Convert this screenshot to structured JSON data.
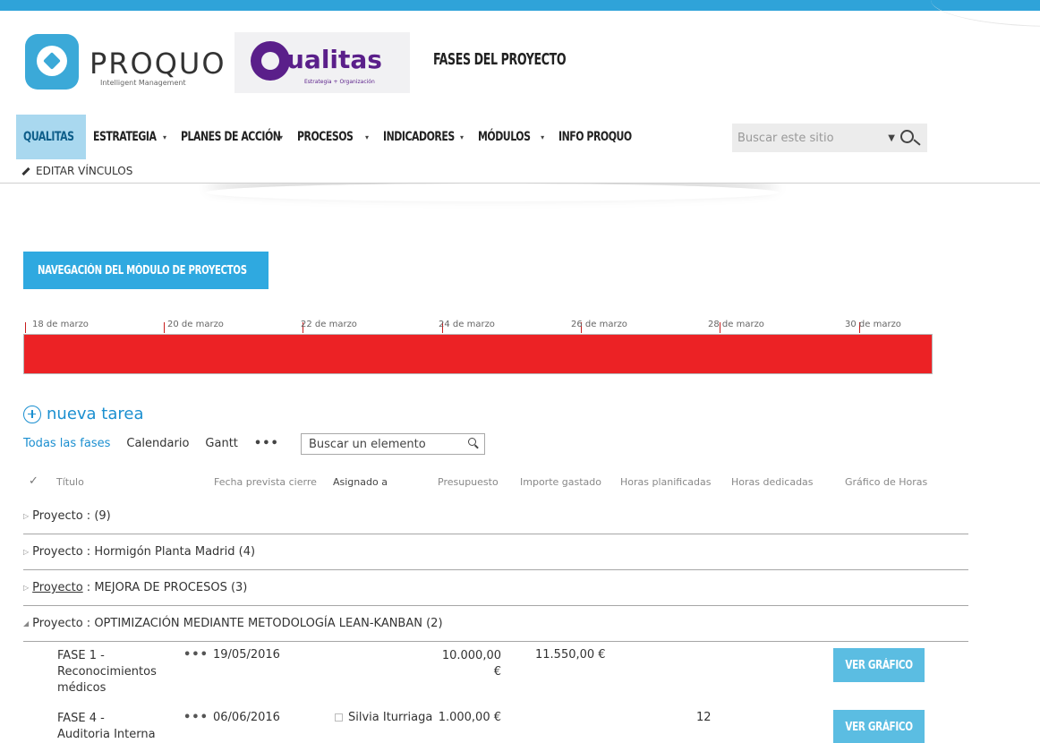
{
  "header": {
    "brand_name": "PROQUO",
    "brand_tagline": "Intelligent Management",
    "partner_name": "ualitas",
    "partner_tagline": "Estrategia + Organización",
    "page_title": "FASES DEL PROYECTO",
    "accent_color": "#2fa3d9"
  },
  "nav": {
    "items": [
      {
        "label": "QUALITAS",
        "active": true
      },
      {
        "label": "ESTRATEGIA",
        "dropdown": true
      },
      {
        "label": "PLANES DE ACCIÓN",
        "dropdown": true
      },
      {
        "label": "PROCESOS",
        "dropdown": true
      },
      {
        "label": "INDICADORES",
        "dropdown": true
      },
      {
        "label": "MÓDULOS",
        "dropdown": true
      },
      {
        "label": "INFO PROQUO"
      }
    ],
    "search_placeholder": "Buscar este sitio",
    "edit_links": "EDITAR VÍNCULOS"
  },
  "module_button": "NAVEGACIÓN DEL MÓDULO DE PROYECTOS",
  "timeline": {
    "labels": [
      "18 de marzo",
      "20 de marzo",
      "22 de marzo",
      "24 de marzo",
      "26 de marzo",
      "28 de marzo",
      "30 de marzo"
    ],
    "bar_color": "#ec2225"
  },
  "list": {
    "new_task": "nueva tarea",
    "views": [
      "Todas las fases",
      "Calendario",
      "Gantt"
    ],
    "more": "•••",
    "search_placeholder": "Buscar un elemento",
    "columns": [
      "Título",
      "Fecha prevista cierre",
      "Asignado a",
      "Presupuesto",
      "Importe gastado",
      "Horas planificadas",
      "Horas dedicadas",
      "Gráfico de Horas"
    ],
    "groups": [
      {
        "prefix": "Proyecto",
        "label": " : (9)",
        "expanded": false
      },
      {
        "prefix": "Proyecto",
        "label": " : Hormigón Planta Madrid (4)",
        "expanded": false
      },
      {
        "prefix": "Proyecto",
        "label": " : MEJORA DE PROCESOS (3)",
        "expanded": false,
        "underline": true
      },
      {
        "prefix": "Proyecto",
        "label": " : OPTIMIZACIÓN MEDIANTE METODOLOGÍA LEAN-KANBAN (2)",
        "expanded": true
      }
    ],
    "rows": [
      {
        "title_lines": [
          "FASE 1 -",
          "Reconocimientos",
          "médicos"
        ],
        "date": "19/05/2016",
        "assigned": "",
        "budget_lines": [
          "10.000,00",
          "€"
        ],
        "spent": "11.550,00 €",
        "planned": "",
        "button": "VER GRÁFICO"
      },
      {
        "title_lines": [
          "FASE 4 -",
          "Auditoria Interna"
        ],
        "date": "06/06/2016",
        "assigned": "Silvia Iturriaga",
        "budget_lines": [
          "1.000,00 €"
        ],
        "spent": "",
        "planned": "12",
        "button": "VER GRÁFICO"
      }
    ]
  }
}
